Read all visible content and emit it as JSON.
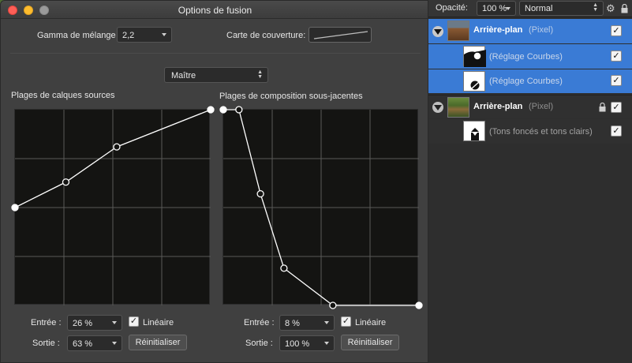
{
  "dialog": {
    "title": "Options de fusion",
    "gamma_label": "Gamma de mélange :",
    "gamma_value": "2,2",
    "coverage_label": "Carte de couverture:",
    "channel_value": "Maître",
    "source_title": "Plages de calques sources",
    "underlying_title": "Plages de composition sous-jacentes",
    "source_controls": {
      "input_label": "Entrée :",
      "input_value": "26 %",
      "output_label": "Sortie :",
      "output_value": "63 %",
      "linear_label": "Linéaire",
      "linear_checked": true,
      "reset_label": "Réinitialiser"
    },
    "underlying_controls": {
      "input_label": "Entrée :",
      "input_value": "8 %",
      "output_label": "Sortie :",
      "output_value": "100 %",
      "linear_label": "Linéaire",
      "linear_checked": true,
      "reset_label": "Réinitialiser"
    },
    "source_curve": [
      [
        0,
        0.5
      ],
      [
        0.26,
        0.63
      ],
      [
        0.52,
        0.81
      ],
      [
        1,
        1
      ]
    ],
    "underlying_curve": [
      [
        0,
        1
      ],
      [
        0.08,
        1
      ],
      [
        0.19,
        0.57
      ],
      [
        0.31,
        0.19
      ],
      [
        0.56,
        0
      ],
      [
        1,
        0
      ]
    ]
  },
  "panel": {
    "opacity_label": "Opacité:",
    "opacity_value": "100 %",
    "blend_mode": "Normal",
    "layers": [
      {
        "name": "Arrière-plan",
        "type": "(Pixel)",
        "selected": true,
        "locked": false,
        "checked": true,
        "children": [
          {
            "name": "(Réglage Courbes)",
            "checked": true
          },
          {
            "name": "(Réglage Courbes)",
            "checked": true
          }
        ]
      },
      {
        "name": "Arrière-plan",
        "type": "(Pixel)",
        "selected": false,
        "locked": true,
        "checked": true,
        "children": [
          {
            "name": "(Tons foncés et tons clairs)",
            "checked": true
          }
        ]
      }
    ]
  },
  "colors": {
    "selection": "#3a7bd5",
    "graph_bg": "#141412",
    "curve": "#ffffff"
  }
}
